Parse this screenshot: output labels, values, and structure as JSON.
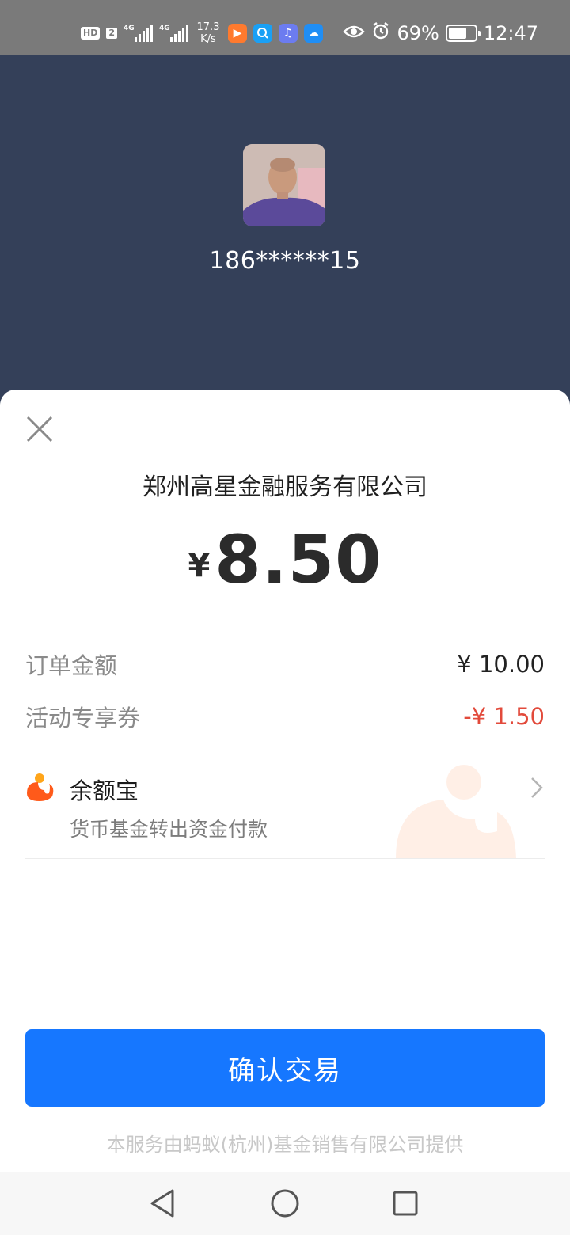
{
  "status_bar": {
    "hd_label": "HD",
    "sim_label": "2",
    "signal_1_tag": "4G",
    "signal_2_tag": "4G",
    "speed_value": "17.3",
    "speed_unit": "K/s",
    "battery_percent": "69%",
    "battery_level": 0.69,
    "time": "12:47",
    "app_icons": [
      "video-app-icon",
      "search-app-icon",
      "music-app-icon",
      "weather-app-icon"
    ]
  },
  "payee": {
    "account": "186******15"
  },
  "sheet": {
    "merchant_name": "郑州高星金融服务有限公司",
    "currency_symbol": "¥",
    "amount": "8.50",
    "order_amount_label": "订单金额",
    "order_amount_value": "¥ 10.00",
    "coupon_label": "活动专享券",
    "coupon_value": "-¥ 1.50",
    "payment_method": {
      "name": "余额宝",
      "description": "货币基金转出资金付款"
    },
    "confirm_label": "确认交易",
    "provider_note": "本服务由蚂蚁(杭州)基金销售有限公司提供"
  },
  "colors": {
    "header_bg": "#344059",
    "primary_button": "#1677ff",
    "discount_red": "#e24a3b",
    "yuebao_orange": "#ff6a1a"
  }
}
